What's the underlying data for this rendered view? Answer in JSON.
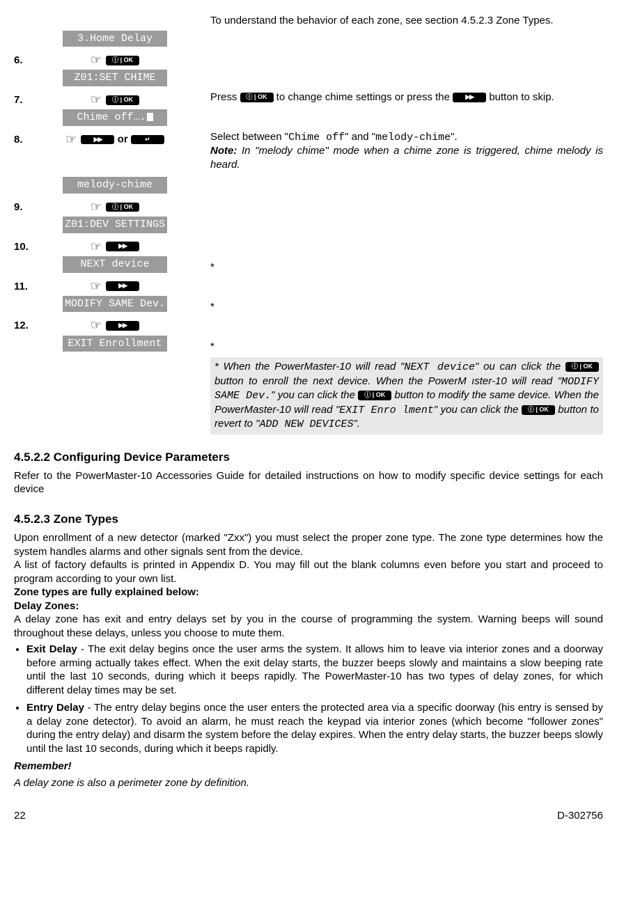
{
  "intro": "To understand the behavior of each zone, see section 4.5.2.3 Zone Types.",
  "steps": {
    "s5_display": "3.Home Delay",
    "s6_num": "6.",
    "s6_display": "Z01:SET CHIME",
    "s7_num": "7.",
    "s7_display": "Chime off….",
    "s7_right_a": "Press ",
    "s7_right_b": " to change chime settings or press the ",
    "s7_right_c": " button to skip.",
    "s8_num": "8.",
    "s8_or": " or ",
    "s8_right_a": "Select between \"",
    "s8_right_b": "Chime off",
    "s8_right_c": "\" and \"",
    "s8_right_d": "melody-chime",
    "s8_right_e": "\".",
    "s8_note": "Note:",
    "s8_note_text": " In \"melody chime\" mode when a chime zone is triggered, chime melody is heard.",
    "s8_display": "melody-chime",
    "s9_num": "9.",
    "s9_display": "Z01:DEV SETTINGS",
    "s10_num": "10.",
    "s10_display": "NEXT device",
    "s10_star": "*",
    "s11_num": "11.",
    "s11_display": "MODIFY SAME Dev.",
    "s11_star": "*",
    "s12_num": "12.",
    "s12_display": "EXIT Enrollment",
    "s12_star": "*"
  },
  "footnote": {
    "a": "* When the PowerMaster-10 will read \"",
    "b": "NEXT device",
    "c": "\" ou can click the ",
    "d": " button to enroll the next device. When the PowerM ıster-10 will read \"",
    "e": "MODIFY SAME Dev.",
    "f": "\" you can click the ",
    "g": " button to modify the same device. When the PowerMaster-10 will read \"",
    "h": "EXIT Enro lment",
    "i": "\" you can click the ",
    "j": " button to revert to \"",
    "k": "ADD NEW DEVICES",
    "l": "\"."
  },
  "sec452": {
    "heading": "4.5.2.2 Configuring Device Parameters",
    "text": "Refer to the PowerMaster-10 Accessories Guide for detailed instructions on how to modify specific device settings for each device"
  },
  "sec453": {
    "heading": "4.5.2.3 Zone Types",
    "p1": "Upon enrollment of a new detector (marked \"Zxx\") you must select the proper zone type. The zone type determines how the system handles alarms and other signals sent from the device.",
    "p2": "A list of factory defaults is printed in Appendix D. You may fill out the blank columns even before you start and proceed to program according to your own list.",
    "p3": "Zone types are fully explained below:",
    "p4": "Delay Zones:",
    "p5": "A delay zone has exit and entry delays set by you in the course of programming the system. Warning beeps will sound throughout these delays, unless you choose to mute them.",
    "li1_label": "Exit Delay",
    "li1": " - The exit delay begins once the user arms the system. It allows him to leave via interior zones and a doorway before arming actually takes effect. When the exit delay starts, the buzzer beeps slowly and maintains a slow beeping rate until the last 10 seconds, during which it beeps rapidly. The PowerMaster-10 has two types of delay zones, for which different delay times may be set.",
    "li2_label": "Entry Delay",
    "li2": " - The entry delay begins once the user enters the protected area via a specific doorway (his entry is sensed by a delay zone detector). To avoid an alarm, he must reach the keypad via interior zones (which become \"follower zones\" during the entry delay) and disarm the system before the delay expires. When the entry delay starts, the buzzer beeps slowly until the last 10 seconds, during which it beeps rapidly.",
    "remember": "Remember!",
    "remember_text": "A delay zone is also a perimeter zone by definition."
  },
  "footer": {
    "page": "22",
    "doc": "D-302756"
  },
  "btn": {
    "ok": "ⓘ | OK",
    "fwd": "▶▶",
    "back": "↵"
  }
}
